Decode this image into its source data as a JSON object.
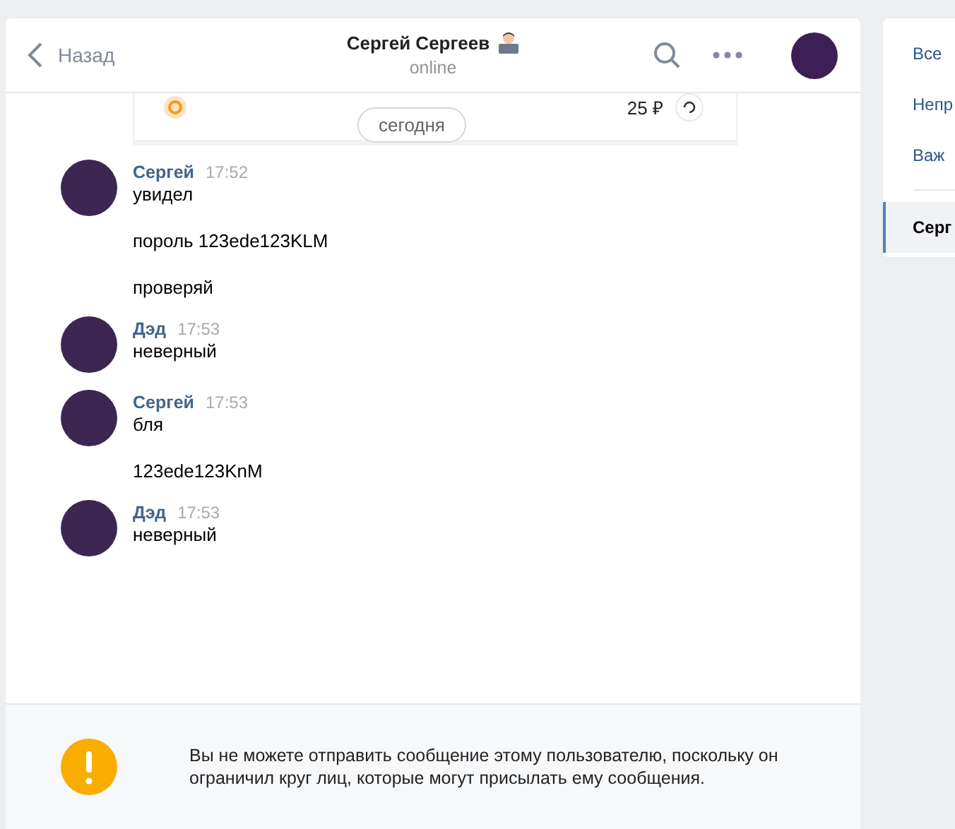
{
  "header": {
    "back": "Назад",
    "title": "Сергей Сергеев",
    "status": "online"
  },
  "pinned_card": {
    "amount": "25 ₽"
  },
  "date_badge": "сегодня",
  "messages": [
    {
      "author": "Сергей",
      "time": "17:52",
      "texts": [
        "увидел",
        "пороль 123ede123KLM",
        "проверяй"
      ]
    },
    {
      "author": "Дэд",
      "time": "17:53",
      "texts": [
        "неверный"
      ]
    },
    {
      "author": "Сергей",
      "time": "17:53",
      "texts": [
        "бля",
        "123ede123KnM"
      ]
    },
    {
      "author": "Дэд",
      "time": "17:53",
      "texts": [
        "неверный"
      ]
    }
  ],
  "notice": "Вы не можете отправить сообщение этому пользователю, поскольку он ограничил круг лиц, которые могут присылать ему сообщения.",
  "sidebar": {
    "items": [
      {
        "label": "Все",
        "selected": false
      },
      {
        "label": "Непр",
        "selected": false
      },
      {
        "label": "Важ",
        "selected": false
      },
      {
        "label": "Серг",
        "selected": true
      }
    ]
  }
}
